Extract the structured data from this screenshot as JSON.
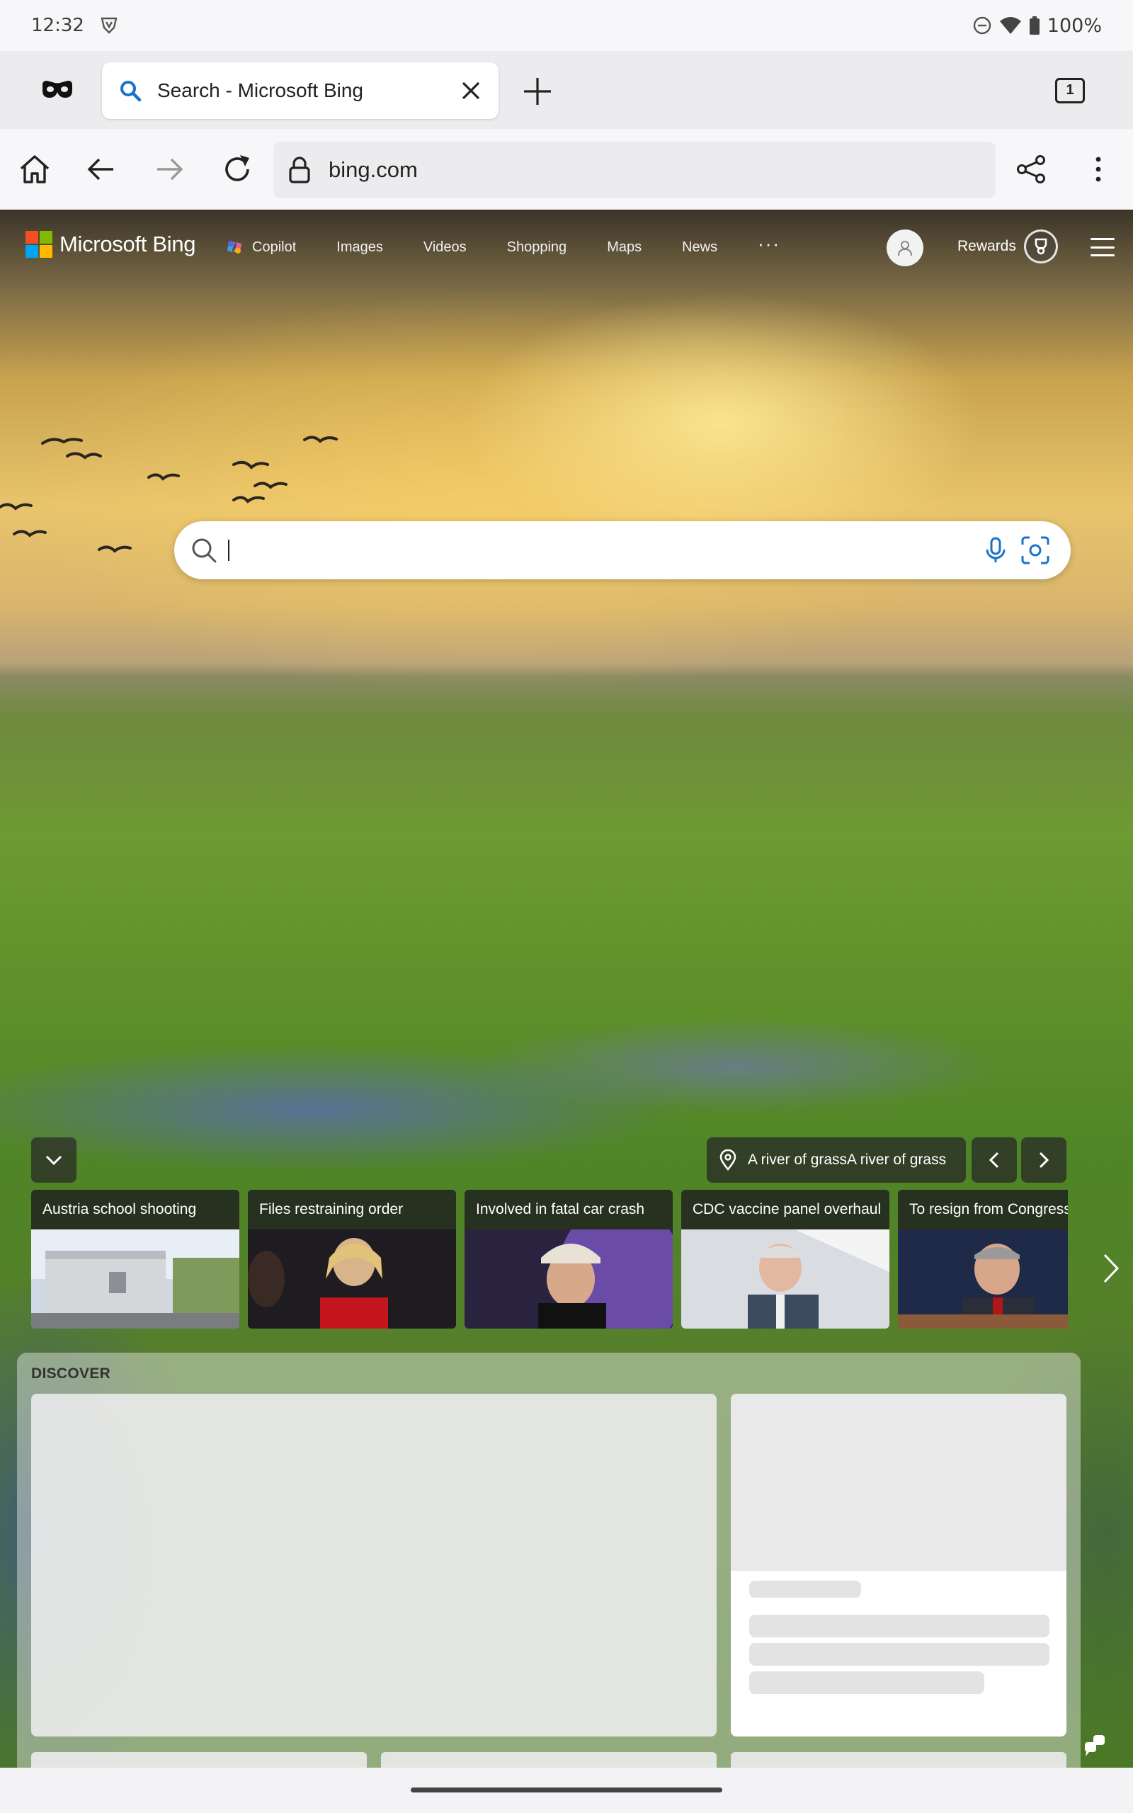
{
  "status_bar": {
    "time": "12:32",
    "battery": "100%"
  },
  "tabs": {
    "active_title": "Search - Microsoft Bing",
    "tab_count": "1"
  },
  "toolbar": {
    "url": "bing.com"
  },
  "bing": {
    "brand": "Microsoft Bing",
    "nav": [
      "Copilot",
      "Images",
      "Videos",
      "Shopping",
      "Maps",
      "News"
    ],
    "more": "···",
    "rewards": "Rewards",
    "image_caption": "A river of grassA river of grass"
  },
  "news": [
    {
      "title": "Austria school shooting"
    },
    {
      "title": "Files restraining order"
    },
    {
      "title": "Involved in fatal car crash"
    },
    {
      "title": "CDC vaccine panel overhaul"
    },
    {
      "title": "To resign from Congress"
    }
  ],
  "discover": {
    "label": "DISCOVER"
  },
  "colors": {
    "ms_red": "#f25022",
    "ms_green": "#7fba00",
    "ms_blue": "#00a4ef",
    "ms_yellow": "#ffb900",
    "search_icon_blue": "#1a73c8"
  }
}
